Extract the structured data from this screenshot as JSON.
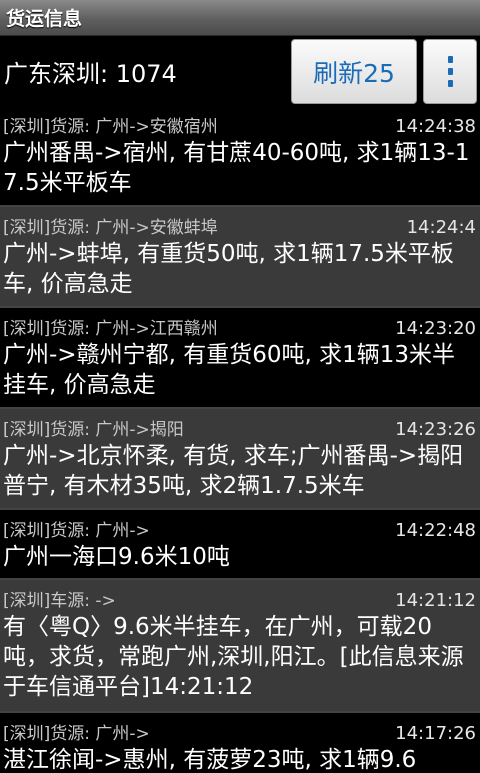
{
  "titlebar": {
    "title": "货运信息"
  },
  "header": {
    "location": "广东深圳: 1074",
    "refresh_label": "刷新25"
  },
  "colors": {
    "accent": "#1a6bb8",
    "row_alt": "#3a3a3a"
  },
  "items": [
    {
      "source": "[深圳]货源: 广州->安徽宿州",
      "time": "14:24:38",
      "content": "广州番禺->宿州, 有甘蔗40-60吨, 求1辆13-17.5米平板车"
    },
    {
      "source": "[深圳]货源: 广州->安徽蚌埠",
      "time": "14:24:4",
      "content": "广州->蚌埠, 有重货50吨, 求1辆17.5米平板车, 价高急走"
    },
    {
      "source": "[深圳]货源: 广州->江西赣州",
      "time": "14:23:20",
      "content": "广州->赣州宁都, 有重货60吨, 求1辆13米半挂车, 价高急走"
    },
    {
      "source": "[深圳]货源: 广州->揭阳",
      "time": "14:23:26",
      "content": "广州->北京怀柔, 有货, 求车;广州番禺->揭阳普宁, 有木材35吨, 求2辆1.7.5米车"
    },
    {
      "source": "[深圳]货源: 广州->",
      "time": "14:22:48",
      "content": "广州一海口9.6米10吨"
    },
    {
      "source": "[深圳]车源: ->",
      "time": "14:21:12",
      "content": "有〈粤Q〉9.6米半挂车，在广州，可载20吨，求货，常跑广州,深圳,阳江。[此信息来源于车信通平台]14:21:12"
    },
    {
      "source": "[深圳]货源: 广州->",
      "time": "14:17:26",
      "content": "湛江徐闻->惠州, 有菠萝23吨, 求1辆9.6"
    }
  ]
}
